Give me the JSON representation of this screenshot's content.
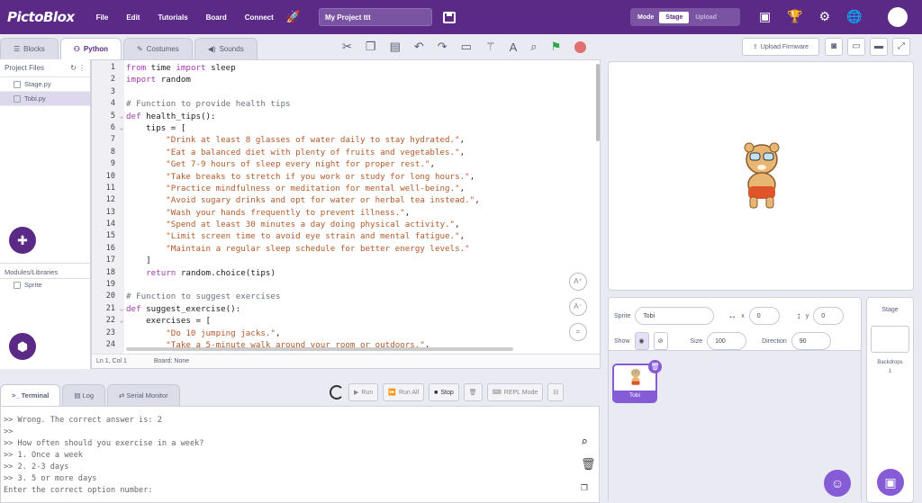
{
  "app": {
    "logo": "PictoBlox",
    "menu": [
      "File",
      "Edit",
      "Tutorials",
      "Board",
      "Connect"
    ],
    "project_name": "My Project ttt",
    "mode_label": "Mode",
    "mode_stage": "Stage",
    "mode_upload": "Upload"
  },
  "tabs": {
    "blocks": "Blocks",
    "python": "Python",
    "costumes": "Costumes",
    "sounds": "Sounds"
  },
  "toolbar": {
    "upload_firmware": "Upload Firmware"
  },
  "files": {
    "header": "Project Files",
    "items": [
      "Stage.py",
      "Tobi.py"
    ],
    "libraries_header": "Modules/Libraries",
    "lib_items": [
      "Sprite"
    ]
  },
  "editor": {
    "lines": [
      {
        "n": "1",
        "html": "<span class='kw'>from</span> time <span class='kw'>import</span> sleep"
      },
      {
        "n": "2",
        "html": "<span class='kw'>import</span> random"
      },
      {
        "n": "3",
        "html": ""
      },
      {
        "n": "4",
        "html": "<span class='cm'># Function to provide health tips</span>"
      },
      {
        "n": "5",
        "f": "v",
        "html": "<span class='kw'>def</span> health_tips():"
      },
      {
        "n": "6",
        "f": "v",
        "html": "    tips = ["
      },
      {
        "n": "7",
        "html": "        <span class='str'>\"Drink at least 8 glasses of water daily to stay hydrated.\"</span>,"
      },
      {
        "n": "8",
        "html": "        <span class='str'>\"Eat a balanced diet with plenty of fruits and vegetables.\"</span>,"
      },
      {
        "n": "9",
        "html": "        <span class='str'>\"Get 7-9 hours of sleep every night for proper rest.\"</span>,"
      },
      {
        "n": "10",
        "html": "        <span class='str'>\"Take breaks to stretch if you work or study for long hours.\"</span>,"
      },
      {
        "n": "11",
        "html": "        <span class='str'>\"Practice mindfulness or meditation for mental well-being.\"</span>,"
      },
      {
        "n": "12",
        "html": "        <span class='str'>\"Avoid sugary drinks and opt for water or herbal tea instead.\"</span>,"
      },
      {
        "n": "13",
        "html": "        <span class='str'>\"Wash your hands frequently to prevent illness.\"</span>,"
      },
      {
        "n": "14",
        "html": "        <span class='str'>\"Spend at least 30 minutes a day doing physical activity.\"</span>,"
      },
      {
        "n": "15",
        "html": "        <span class='str'>\"Limit screen time to avoid eye strain and mental fatigue.\"</span>,"
      },
      {
        "n": "16",
        "html": "        <span class='str'>\"Maintain a regular sleep schedule for better energy levels.\"</span>"
      },
      {
        "n": "17",
        "html": "    ]"
      },
      {
        "n": "18",
        "html": "    <span class='kw'>return</span> random.choice(tips)"
      },
      {
        "n": "19",
        "html": ""
      },
      {
        "n": "20",
        "html": "<span class='cm'># Function to suggest exercises</span>"
      },
      {
        "n": "21",
        "f": "v",
        "html": "<span class='kw'>def</span> suggest_exercise():"
      },
      {
        "n": "22",
        "f": "v",
        "html": "    exercises = ["
      },
      {
        "n": "23",
        "html": "        <span class='str'>\"Do 10 jumping jacks.\"</span>,"
      },
      {
        "n": "24",
        "html": "        <span class='str'>\"Take a 5-minute walk around your room or outdoors.\"</span>,"
      }
    ],
    "status_pos": "Ln 1, Col 1",
    "status_board": "Board: None"
  },
  "bottom": {
    "tabs": [
      "Terminal",
      "Log",
      "Serial Monitor"
    ],
    "run": "Run",
    "run_all": "Run All",
    "stop": "Stop",
    "repl": "REPL Mode",
    "terminal_lines": [
      ">> Wrong. The correct answer is: 2",
      ">>",
      ">> How often should you exercise in a week?",
      ">> 1. Once a week",
      ">> 2. 2-3 days",
      ">> 3. 5 or more days",
      "Enter the correct option number:"
    ]
  },
  "sprite": {
    "label": "Sprite",
    "name": "Tobi",
    "x_label": "x",
    "x": "0",
    "y_label": "y",
    "y": "0",
    "show_label": "Show",
    "size_label": "Size",
    "size": "100",
    "direction_label": "Direction",
    "direction": "90",
    "thumb_name": "Tobi"
  },
  "stage_panel": {
    "title": "Stage",
    "backdrops_label": "Backdrops",
    "backdrops_count": "1"
  }
}
